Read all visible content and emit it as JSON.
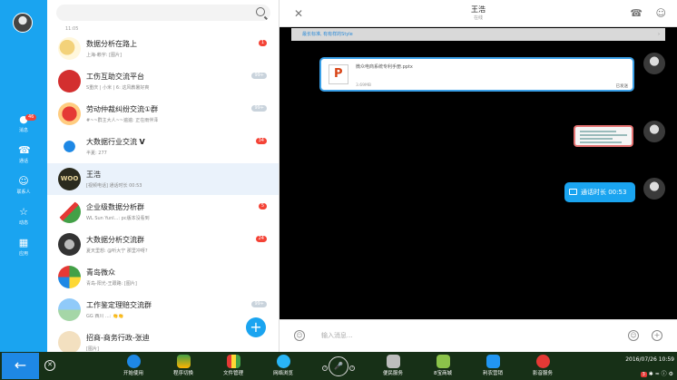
{
  "nav": {
    "items": [
      {
        "label": "消息",
        "icon": "chat-bubble-icon",
        "badge": "46"
      },
      {
        "label": "通话",
        "icon": "phone-icon"
      },
      {
        "label": "联系人",
        "icon": "contacts-icon"
      },
      {
        "label": "动态",
        "icon": "star-icon"
      },
      {
        "label": "应用",
        "icon": "apps-grid-icon"
      }
    ]
  },
  "list": {
    "time_label": "11:05",
    "rows": [
      {
        "name": "数据分析在路上",
        "preview": "上海-赖宇: [图片]",
        "badge": "1"
      },
      {
        "name": "工伤互助交流平台",
        "preview": "S重庆 | 小米 | 6: 这风教暑好爽",
        "badge": "99+"
      },
      {
        "name": "劳动仲裁纠纷交流①群",
        "preview": "#~~群主大人~~遍遍: 正在雨伴泽",
        "badge": "99+"
      },
      {
        "name": "大数据行业交流",
        "preview": "半夏: 277",
        "badge": "34"
      },
      {
        "name": "王浩",
        "preview": "[视频电话] 通话时长 00:53",
        "badge": ""
      },
      {
        "name": "企业级数据分析群",
        "preview": "WL Sun Yunl...: pc版本没看到",
        "badge": "5"
      },
      {
        "name": "大数据分析交流群",
        "preview": "夏天里想: @听大宁 那里冲呀?",
        "badge": "24"
      },
      {
        "name": "青岛微众",
        "preview": "青岛-阳光-王跟路: [图片]",
        "badge": ""
      },
      {
        "name": "工作鉴定理赔交流群",
        "preview": "GG   西川   ...: 👏👏",
        "badge": "99+"
      },
      {
        "name": "招商-商务行政-张迪",
        "preview": "[图片]",
        "badge": ""
      }
    ]
  },
  "chat": {
    "title": "王浩",
    "subtitle": "在线",
    "banner": "最长标准, 有有样的Style",
    "file": {
      "name": "微众电商系统专利手册.pptx",
      "size": "3.69MB",
      "status": "已发送"
    },
    "call_text": "通话时长 00:53",
    "input_placeholder": "输入消息..."
  },
  "taskbar": {
    "apps": [
      {
        "label": "开始使用",
        "color": "#1e88e5"
      },
      {
        "label": "程序切换",
        "color": "#4caf50"
      },
      {
        "label": "文件管理",
        "color": "#ff9800"
      },
      {
        "label": "网络浏览",
        "color": "#2196f3"
      },
      {
        "label": "便民服务",
        "color": "#9e9e9e"
      },
      {
        "label": "8宝商城",
        "color": "#8bc34a"
      },
      {
        "label": "利农营销",
        "color": "#2196f3"
      },
      {
        "label": "影音服务",
        "color": "#e53935"
      }
    ],
    "clock": "2016/07/26 10:59",
    "tray_badge": "3"
  }
}
